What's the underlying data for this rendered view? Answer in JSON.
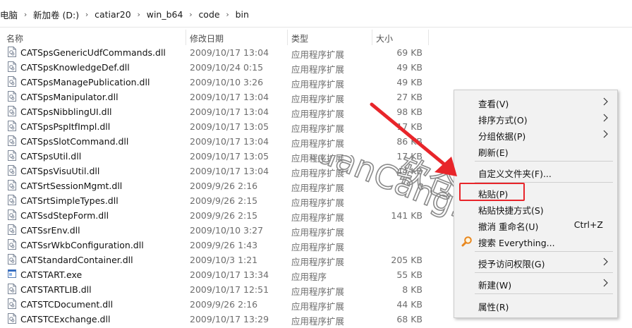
{
  "breadcrumb": {
    "items": [
      "电脑",
      "新加卷 (D:)",
      "catiar20",
      "win_b64",
      "code",
      "bin"
    ]
  },
  "columns": {
    "name": "名称",
    "date": "修改日期",
    "type": "类型",
    "size": "大小"
  },
  "files": [
    {
      "name": "CATSpsGenericUdfCommands.dll",
      "date": "2009/10/17 13:04",
      "type": "应用程序扩展",
      "size": "69 KB",
      "icon": "dll-file-icon"
    },
    {
      "name": "CATSpsKnowledgeDef.dll",
      "date": "2009/10/24 0:15",
      "type": "应用程序扩展",
      "size": "49 KB",
      "icon": "dll-file-icon"
    },
    {
      "name": "CATSpsManagePublication.dll",
      "date": "2009/10/10 3:26",
      "type": "应用程序扩展",
      "size": "49 KB",
      "icon": "dll-file-icon"
    },
    {
      "name": "CATSpsManipulator.dll",
      "date": "2009/10/17 13:04",
      "type": "应用程序扩展",
      "size": "27 KB",
      "icon": "dll-file-icon"
    },
    {
      "name": "CATSpsNibblingUI.dll",
      "date": "2009/10/17 13:04",
      "type": "应用程序扩展",
      "size": "98 KB",
      "icon": "dll-file-icon"
    },
    {
      "name": "CATSpsPspItfImpl.dll",
      "date": "2009/10/17 13:05",
      "type": "应用程序扩展",
      "size": "17 KB",
      "icon": "dll-file-icon"
    },
    {
      "name": "CATSpsSlotCommand.dll",
      "date": "2009/10/17 13:04",
      "type": "应用程序扩展",
      "size": "86 KB",
      "icon": "dll-file-icon"
    },
    {
      "name": "CATSpsUtil.dll",
      "date": "2009/10/17 13:05",
      "type": "应用程序扩展",
      "size": "17 KB",
      "icon": "dll-file-icon"
    },
    {
      "name": "CATSpsVisuUtil.dll",
      "date": "2009/10/17 13:04",
      "type": "应用程序扩展",
      "size": "44 KB",
      "icon": "dll-file-icon"
    },
    {
      "name": "CATSrtSessionMgmt.dll",
      "date": "2009/9/26 2:16",
      "type": "应用程序扩展",
      "size": "",
      "icon": "dll-file-icon"
    },
    {
      "name": "CATSrtSimpleTypes.dll",
      "date": "2009/9/26 2:15",
      "type": "应用程序扩展",
      "size": "",
      "icon": "dll-file-icon"
    },
    {
      "name": "CATSsdStepForm.dll",
      "date": "2009/9/26 2:15",
      "type": "应用程序扩展",
      "size": "141 KB",
      "icon": "dll-file-icon"
    },
    {
      "name": "CATSsrEnv.dll",
      "date": "2009/10/10 3:27",
      "type": "应用程序扩展",
      "size": "",
      "icon": "dll-file-icon"
    },
    {
      "name": "CATSsrWkbConfiguration.dll",
      "date": "2009/9/26 1:43",
      "type": "应用程序扩展",
      "size": "",
      "icon": "dll-file-icon"
    },
    {
      "name": "CATStandardContainer.dll",
      "date": "2009/10/3 1:21",
      "type": "应用程序扩展",
      "size": "205 KB",
      "icon": "dll-file-icon"
    },
    {
      "name": "CATSTART.exe",
      "date": "2009/10/17 13:34",
      "type": "应用程序",
      "size": "55 KB",
      "icon": "exe-file-icon"
    },
    {
      "name": "CATSTARTLIB.dll",
      "date": "2009/10/17 12:51",
      "type": "应用程序扩展",
      "size": "8 KB",
      "icon": "dll-file-icon"
    },
    {
      "name": "CATSTCDocument.dll",
      "date": "2009/9/26 2:16",
      "type": "应用程序扩展",
      "size": "44 KB",
      "icon": "dll-file-icon"
    },
    {
      "name": "CATSTCExchange.dll",
      "date": "2009/10/17 13:29",
      "type": "应用程序扩展",
      "size": "68 KB",
      "icon": "dll-file-icon"
    }
  ],
  "context_menu": {
    "view": "查看(V)",
    "sort_by": "排序方式(O)",
    "group_by": "分组依据(P)",
    "refresh": "刷新(E)",
    "customize_folder": "自定义文件夹(F)...",
    "paste": "粘贴(P)",
    "paste_shortcut": "粘贴快捷方式(S)",
    "undo_rename": "撤消 重命名(U)",
    "undo_shortcut": "Ctrl+Z",
    "search_everything": "搜索 Everything...",
    "grant_access": "授予访问权限(G)",
    "new": "新建(W)",
    "properties": "属性(R)"
  },
  "watermark": {
    "text": "RuanCang.Net",
    "cn": "软仓"
  },
  "colors": {
    "highlight_red": "#e8252a",
    "menu_bg": "#f2f2f2"
  },
  "icons": {
    "search_everything": "magnifier-icon",
    "submenu_arrow": "chevron-right-icon"
  }
}
